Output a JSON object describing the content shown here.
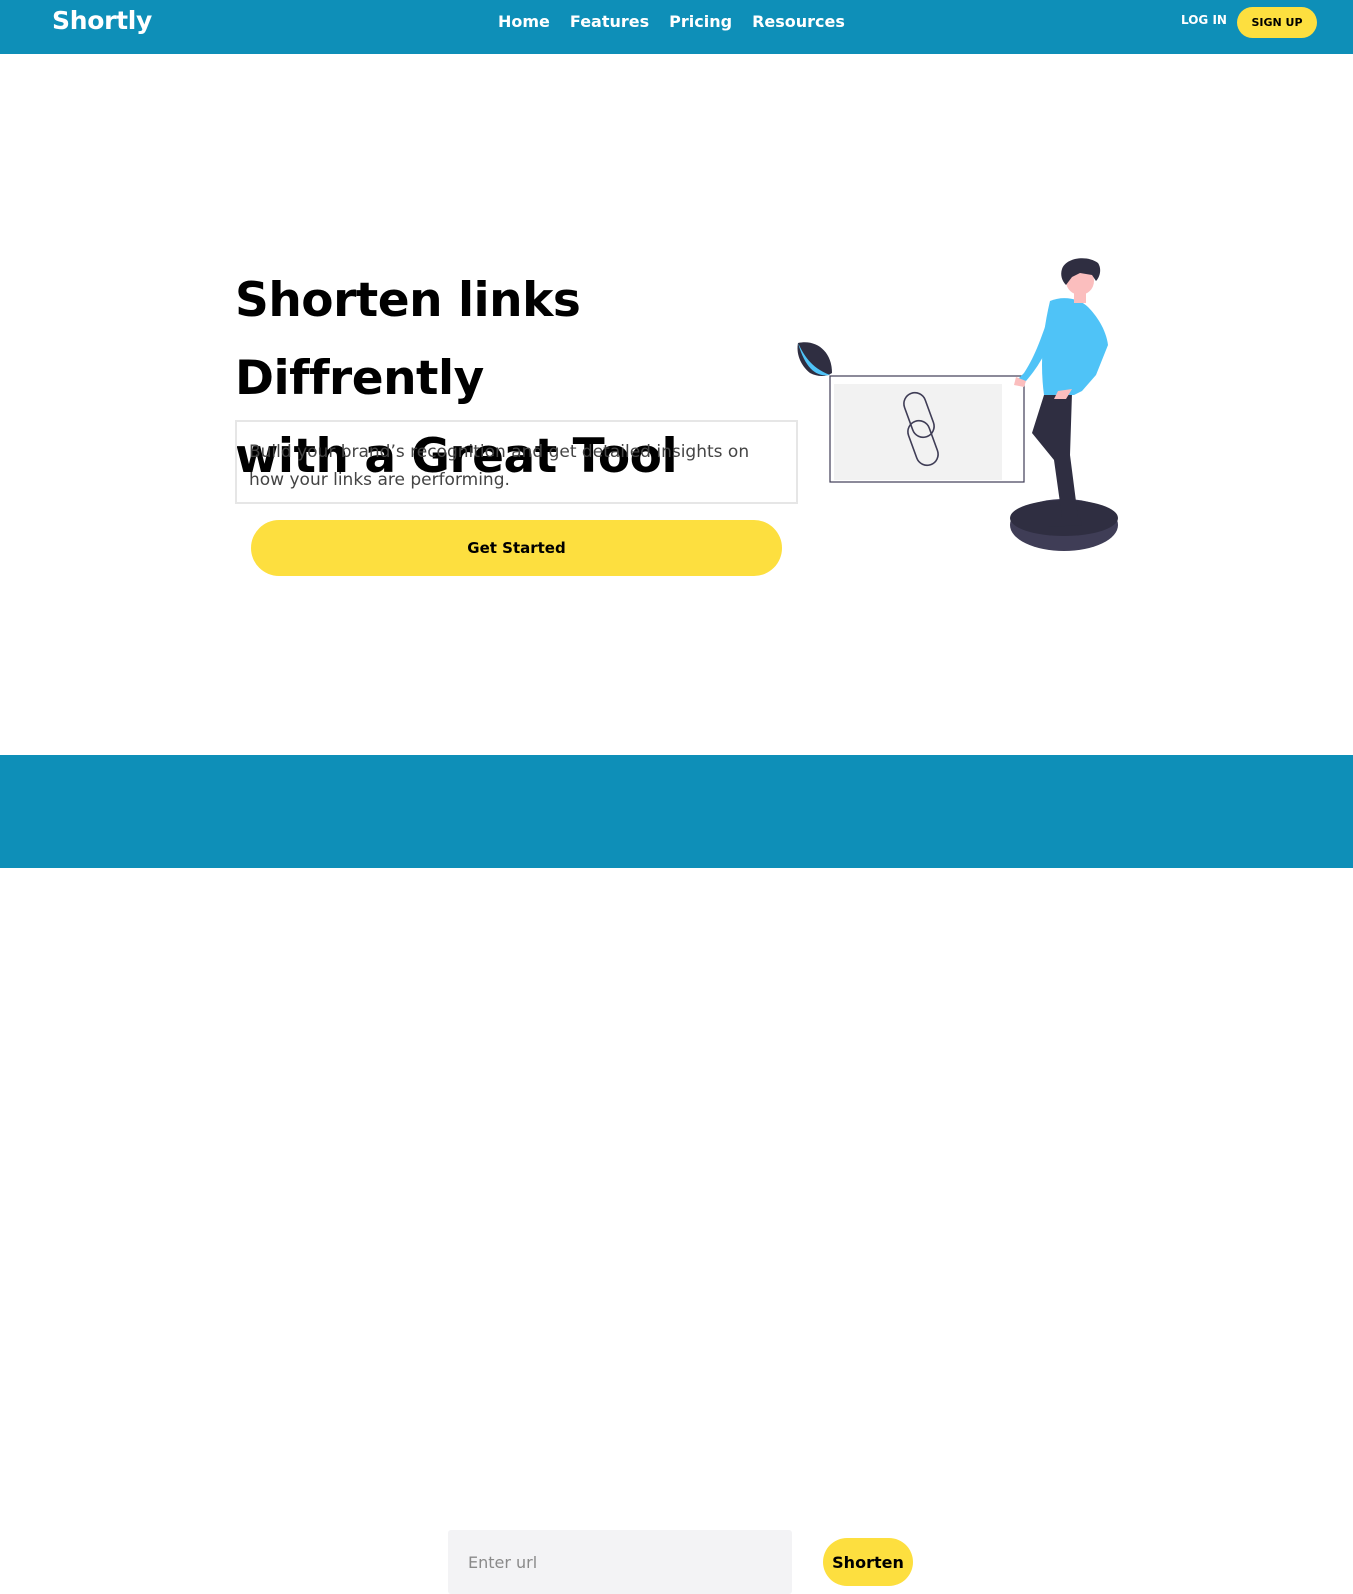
{
  "header": {
    "logo": "Shortly",
    "nav": [
      "Home",
      "Features",
      "Pricing",
      "Resources"
    ],
    "login_label": "LOG IN",
    "signup_label": "SIGN UP"
  },
  "hero": {
    "title_line1": "Shorten links Diffrently",
    "title_line2": "with a Great Tool",
    "description": "Build your brand’s recognition and get detailed insights on how your links are performing.",
    "cta_label": "Get Started",
    "illustration": "person-with-link-card-illustration"
  },
  "shortener": {
    "placeholder": "Enter url",
    "value": "",
    "button_label": "Shorten"
  },
  "colors": {
    "primary": "#0e8fb8",
    "accent": "#fddf3f",
    "text": "#000000"
  }
}
